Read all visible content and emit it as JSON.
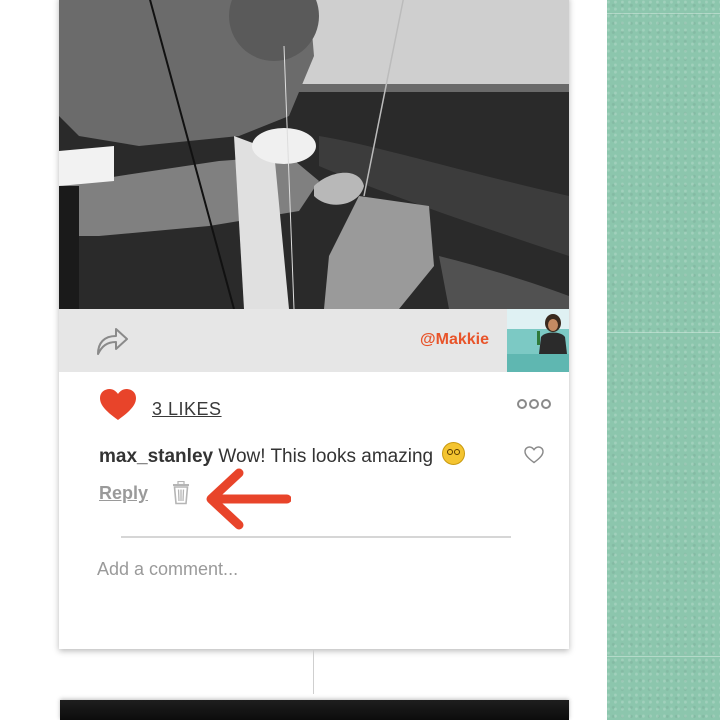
{
  "post": {
    "tagged_user": "@Makkie",
    "likes_label": "3 LIKES",
    "icons": {
      "share": "share-arrow-icon",
      "like": "heart-filled-icon",
      "more": "more-options-icon",
      "comment_like": "heart-outline-icon",
      "delete": "trash-icon"
    },
    "colors": {
      "accent": "#e8542a",
      "heart": "#e8442a",
      "side_panel": "#8cc6ad"
    }
  },
  "comment": {
    "username": "max_stanley",
    "text": "Wow! This looks amazing",
    "emoji_name": "star-struck-emoji",
    "reply_label": "Reply"
  },
  "new_comment": {
    "placeholder": "Add a comment..."
  }
}
